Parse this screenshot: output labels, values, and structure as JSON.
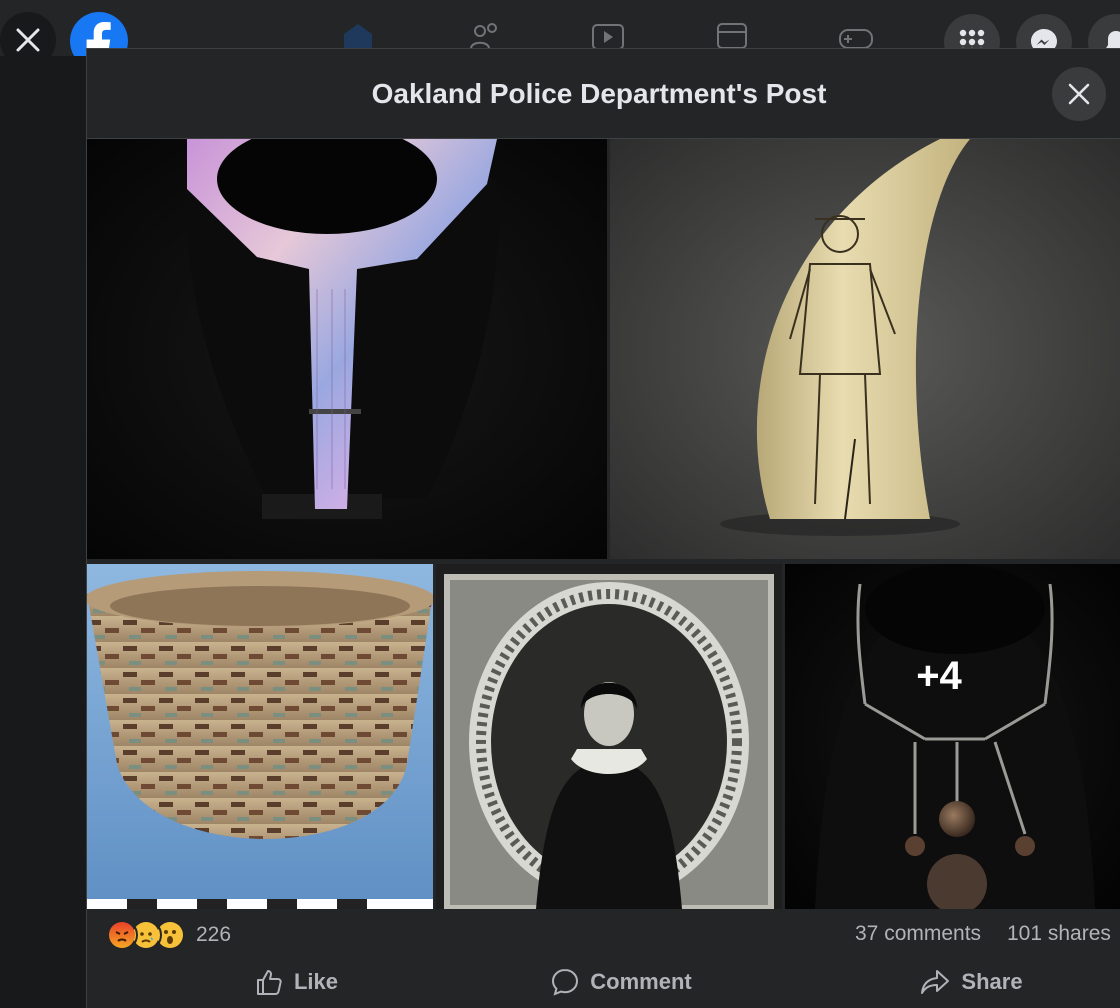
{
  "dialog": {
    "title": "Oakland Police Department's Post"
  },
  "photos": {
    "more_count": "+4"
  },
  "stats": {
    "reaction_count": "226",
    "reaction_icons": [
      "angry-emoji",
      "sad-emoji",
      "wow-emoji"
    ],
    "comments": "37 comments",
    "shares": "101 shares"
  },
  "actions": {
    "like": "Like",
    "comment": "Comment",
    "share": "Share"
  },
  "colors": {
    "brand": "#1877f2",
    "background": "#18191a",
    "surface": "#242526",
    "muted_text": "#b0b3b8"
  }
}
